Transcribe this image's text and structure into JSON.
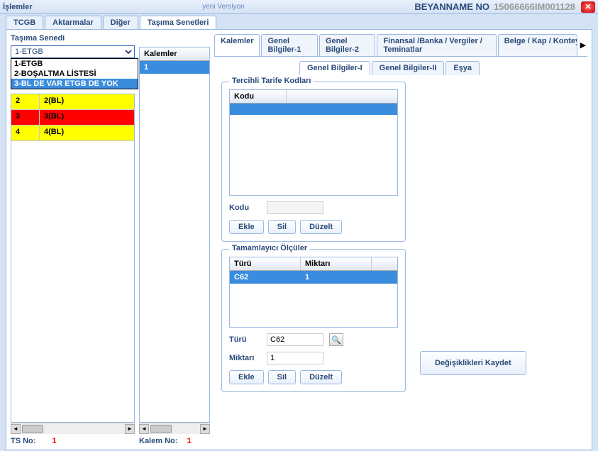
{
  "titlebar": {
    "title": "İşlemler",
    "version": "yeni Versiyon",
    "beyannameno_label": "BEYANNAME NO",
    "beyannameno": "15066666IM001128"
  },
  "topnav": [
    "TCGB",
    "Aktarmalar",
    "Diğer",
    "Taşıma Senetleri"
  ],
  "topnav_active": 3,
  "left": {
    "label": "Taşıma Senedi",
    "selected": "1-ETGB",
    "options": [
      "1-ETGB",
      "2-BOŞALTMA LİSTESİ",
      "3-BL DE VAR ETGB DE YOK"
    ],
    "rows": [
      {
        "n": "2",
        "v": "2(BL)",
        "cls": "row-yellow"
      },
      {
        "n": "3",
        "v": "3(BL)",
        "cls": "row-red"
      },
      {
        "n": "4",
        "v": "4(BL)",
        "cls": "row-yellow"
      }
    ],
    "tsno_label": "TS No:",
    "tsno": "1"
  },
  "middle": {
    "header": "Kalemler",
    "rows": [
      "1"
    ],
    "kalemno_label": "Kalem No:",
    "kalemno": "1"
  },
  "subtabs": [
    "Kalemler",
    "Genel Bilgiler-1",
    "Genel Bilgiler-2",
    "Finansal /Banka / Vergiler / Teminatlar",
    "Belge / Kap / Konteyner"
  ],
  "subtabs_active": 0,
  "innertabs": [
    "Genel Bilgiler-I",
    "Genel Bilgiler-II",
    "Eşya"
  ],
  "innertabs_active": 0,
  "tercihli": {
    "legend": "Tercihli Tarife Kodları",
    "header": "Kodu",
    "kodu_label": "Kodu",
    "kodu_value": "",
    "ekle": "Ekle",
    "sil": "Sil",
    "duzelt": "Düzelt"
  },
  "tamamlayici": {
    "legend": "Tamamlayıcı Ölçüler",
    "headers": [
      "Türü",
      "Miktarı"
    ],
    "rows": [
      {
        "turu": "C62",
        "miktari": "1"
      }
    ],
    "turu_label": "Türü",
    "turu_value": "C62",
    "miktari_label": "Miktarı",
    "miktari_value": "1",
    "ekle": "Ekle",
    "sil": "Sil",
    "duzelt": "Düzelt"
  },
  "save": "Değişiklikleri Kaydet"
}
